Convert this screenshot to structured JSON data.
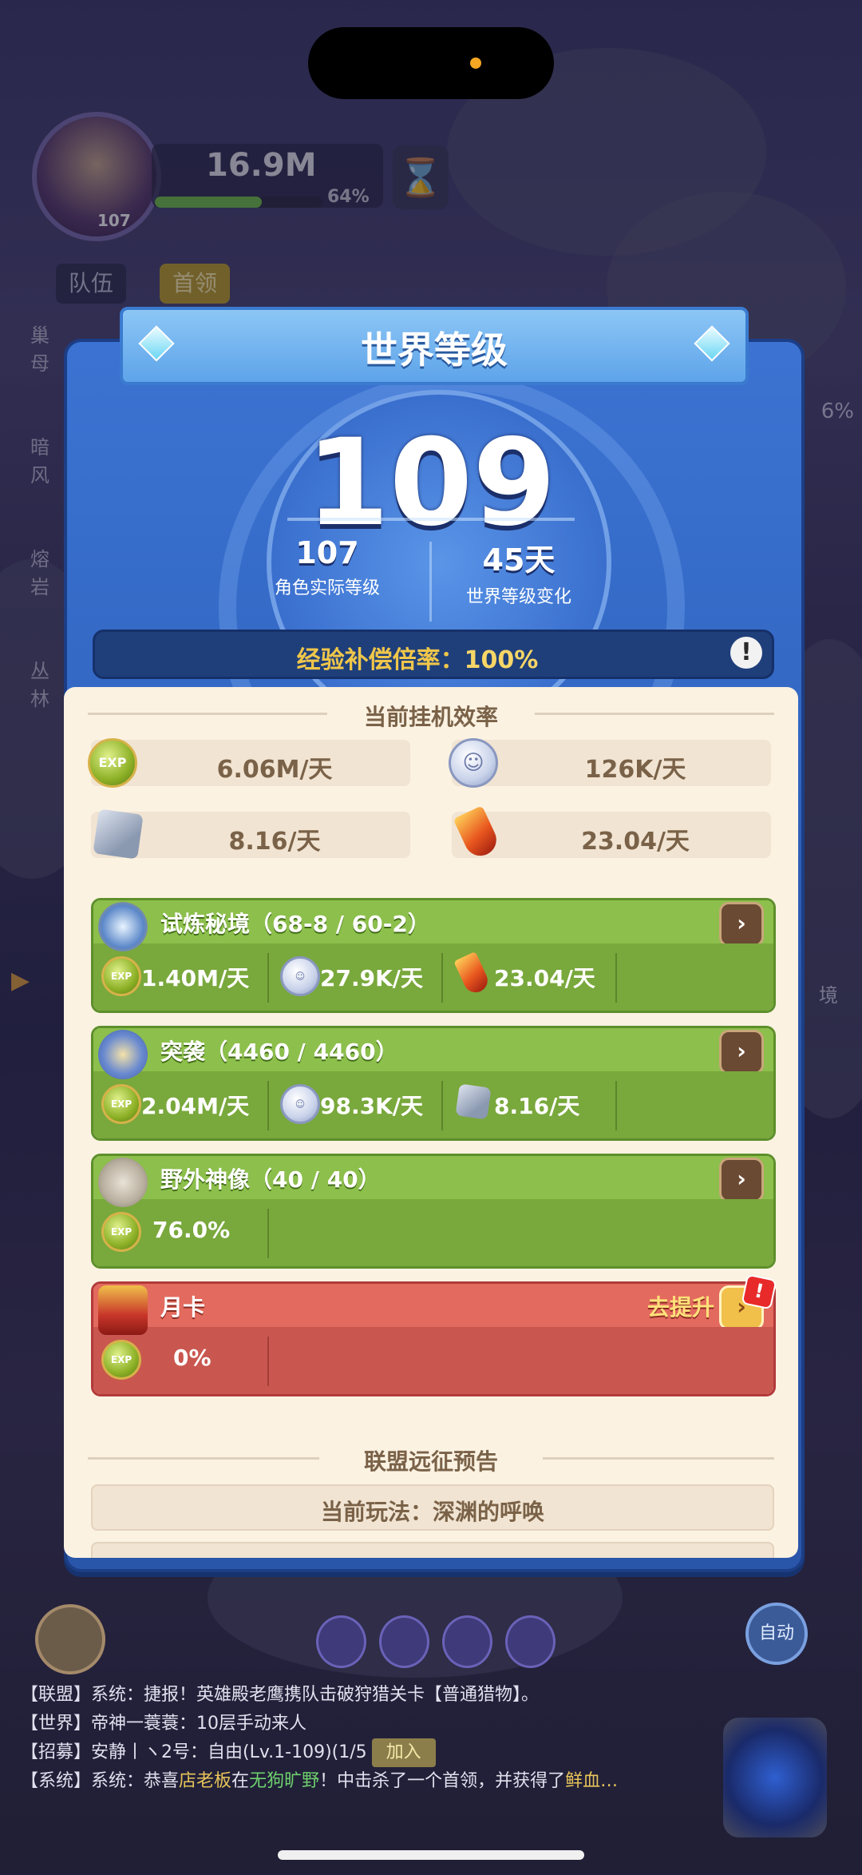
{
  "colors": {
    "panel_blue": "#3368c4",
    "cream": "#fbf2e2",
    "green_head": "#8dbf4c",
    "green_body": "#79a83c",
    "red_head": "#e36a5e",
    "red_body": "#c9574f",
    "gold_text": "#f0c64a"
  },
  "hud": {
    "hero_level": "107",
    "power": "16.9M",
    "power_progress_pct": 64,
    "power_pct_label": "64%",
    "tab_team": "队伍",
    "tab_boss": "首领",
    "side_labels": [
      "巢母",
      "暗风",
      "熔岩",
      "丛林"
    ],
    "right_badge": "6%",
    "right_lower_label": "境",
    "auto_label": "自动"
  },
  "modal": {
    "title": "世界等级",
    "world_level": "109",
    "actual_level_value": "107",
    "actual_level_label": "角色实际等级",
    "change_value": "45天",
    "change_label": "世界等级变化",
    "exp_comp_label": "经验补偿倍率：",
    "exp_comp_value": "100%",
    "info_icon": "!",
    "idle_title": "当前挂机效率",
    "idle": {
      "exp": "6.06M/天",
      "coin": "126K/天",
      "ore": "8.16/天",
      "crystal": "23.04/天"
    },
    "groups": {
      "trial": {
        "name": "试炼秘境（68-8 / 60-2）",
        "exp": "1.40M/天",
        "coin": "27.9K/天",
        "crystal": "23.04/天"
      },
      "raid": {
        "name": "突袭（4460 / 4460）",
        "exp": "2.04M/天",
        "coin": "98.3K/天",
        "ore": "8.16/天"
      },
      "statue": {
        "name": "野外神像（40 / 40）",
        "exp": "76.0%"
      },
      "card": {
        "name": "月卡",
        "upgrade": "去提升",
        "exp": "0%"
      }
    },
    "alliance_title": "联盟远征预告",
    "current_play": "当前玩法：深渊的呼唤",
    "exp_icon_text": "EXP",
    "coin_icon_text": "☺",
    "go_glyph": "›",
    "alert_glyph": "!"
  },
  "chat": [
    {
      "channel": "【联盟】",
      "text": "系统：捷报！英雄殿老鹰携队击破狩猎关卡【普通猎物】。"
    },
    {
      "channel": "【世界】",
      "text": "帝神一蓑蓑：10层手动来人"
    },
    {
      "channel": "【招募】",
      "text": "安静丨ヽ2号：自由(Lv.1-109)(1/5",
      "button": "加入"
    },
    {
      "channel": "【系统】",
      "text": "系统：恭喜",
      "hl1": "店老板",
      "mid": "在",
      "hl2": "无狗旷野",
      "tail": "！中击杀了一个首领，并获得了",
      "hl3": "鲜血…"
    }
  ]
}
